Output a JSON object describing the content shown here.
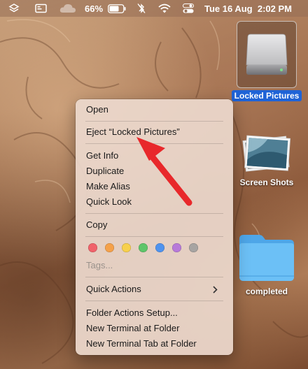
{
  "menubar": {
    "battery_percent": "66%",
    "datetime": "Tue 16 Aug  2:02 PM",
    "icons": [
      "layers-icon",
      "display-icon",
      "cloud-icon",
      "battery-icon",
      "bluetooth-icon",
      "wifi-icon",
      "control-center-icon"
    ]
  },
  "desktop": {
    "items": [
      {
        "label": "Locked Pictures",
        "icon": "external-drive-icon",
        "selected": true
      },
      {
        "label": "Screen Shots",
        "icon": "photo-stack-icon",
        "selected": false
      },
      {
        "label": "completed",
        "icon": "folder-icon",
        "selected": false
      }
    ]
  },
  "context_menu": {
    "open": "Open",
    "eject": "Eject “Locked Pictures”",
    "get_info": "Get Info",
    "duplicate": "Duplicate",
    "make_alias": "Make Alias",
    "quick_look": "Quick Look",
    "copy": "Copy",
    "tags_placeholder": "Tags...",
    "quick_actions": "Quick Actions",
    "folder_actions_setup": "Folder Actions Setup...",
    "new_terminal_at_folder": "New Terminal at Folder",
    "new_terminal_tab_at_folder": "New Terminal Tab at Folder",
    "tag_colors": [
      "#f0626a",
      "#f5a14a",
      "#f7d04c",
      "#5ec56a",
      "#4f93ee",
      "#b77ad9",
      "#a7a4a2"
    ]
  },
  "annotation": {
    "arrow_color": "#e8282b"
  }
}
